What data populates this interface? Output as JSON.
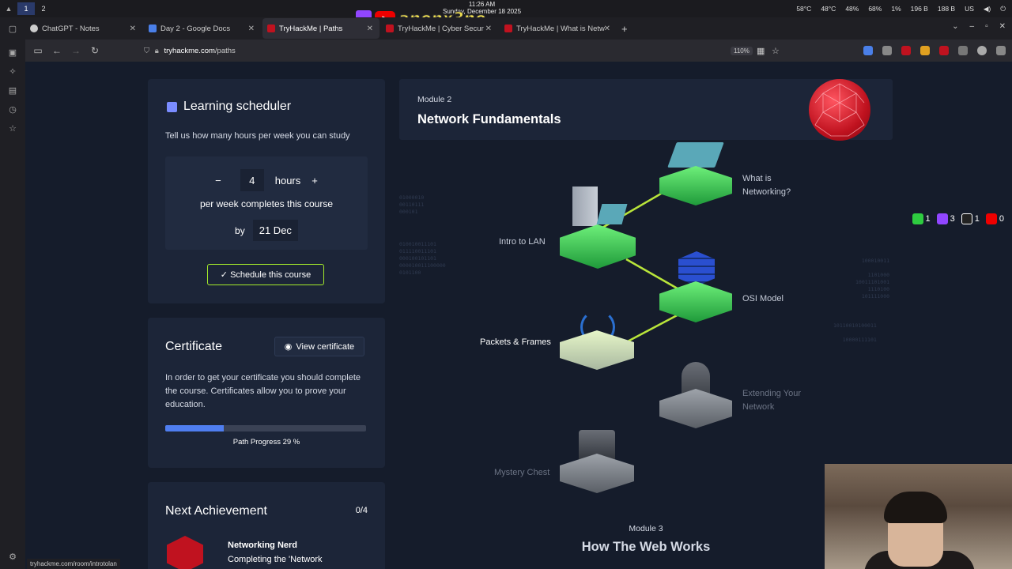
{
  "system": {
    "workspaces": [
      "1",
      "2"
    ],
    "clock_time": "11:26 AM",
    "clock_date": "Sunday, December 18 2025",
    "stream_handle": "anonx3no",
    "tray": [
      "58°C",
      "48°C",
      "48%",
      "68%",
      "1%",
      "196 B",
      "188 B",
      "US"
    ]
  },
  "tabs": [
    {
      "label": "ChatGPT - Notes",
      "color": "#cccccc"
    },
    {
      "label": "Day 2 - Google Docs",
      "color": "#4a7fe8"
    },
    {
      "label": "TryHackMe | Paths",
      "color": "#c0121f"
    },
    {
      "label": "TryHackMe | Cyber Secur",
      "color": "#c0121f"
    },
    {
      "label": "TryHackMe | What is Netw",
      "color": "#c0121f"
    }
  ],
  "url": {
    "domain": "tryhackme.com",
    "path": "/paths",
    "zoom": "110%"
  },
  "scheduler": {
    "title": "Learning scheduler",
    "prompt": "Tell us how many hours per week you can study",
    "minus": "−",
    "hours_value": "4",
    "hours_label": "hours",
    "plus": "+",
    "per_week_text": "per week completes this course",
    "by_label": "by",
    "by_date": "21 Dec",
    "schedule_button": "✓ Schedule this course"
  },
  "certificate": {
    "title": "Certificate",
    "view_button": "View certificate",
    "description": "In order to get your certificate you should complete the course. Certificates allow you to prove your education.",
    "progress_label": "Path Progress 29 %",
    "progress_fraction": 0.29
  },
  "achievement": {
    "title": "Next Achievement",
    "count": "0/4",
    "name": "Networking Nerd",
    "desc": "Completing the 'Network"
  },
  "module2": {
    "kicker": "Module 2",
    "title": "Network Fundamentals",
    "rooms": {
      "what_is_networking": "What is Networking?",
      "intro_lan": "Intro to LAN",
      "osi": "OSI Model",
      "packets": "Packets & Frames",
      "extending": "Extending Your Network",
      "mystery": "Mystery Chest"
    }
  },
  "module3": {
    "kicker": "Module 3",
    "title": "How The Web Works"
  },
  "social": [
    {
      "label": "1",
      "color": "#2ecc40"
    },
    {
      "label": "3",
      "color": "#9146ff"
    },
    {
      "label": "1",
      "color": "#111111"
    },
    {
      "label": "0",
      "color": "#ee0000"
    }
  ],
  "status_url": "tryhackme.com/room/introtolan"
}
